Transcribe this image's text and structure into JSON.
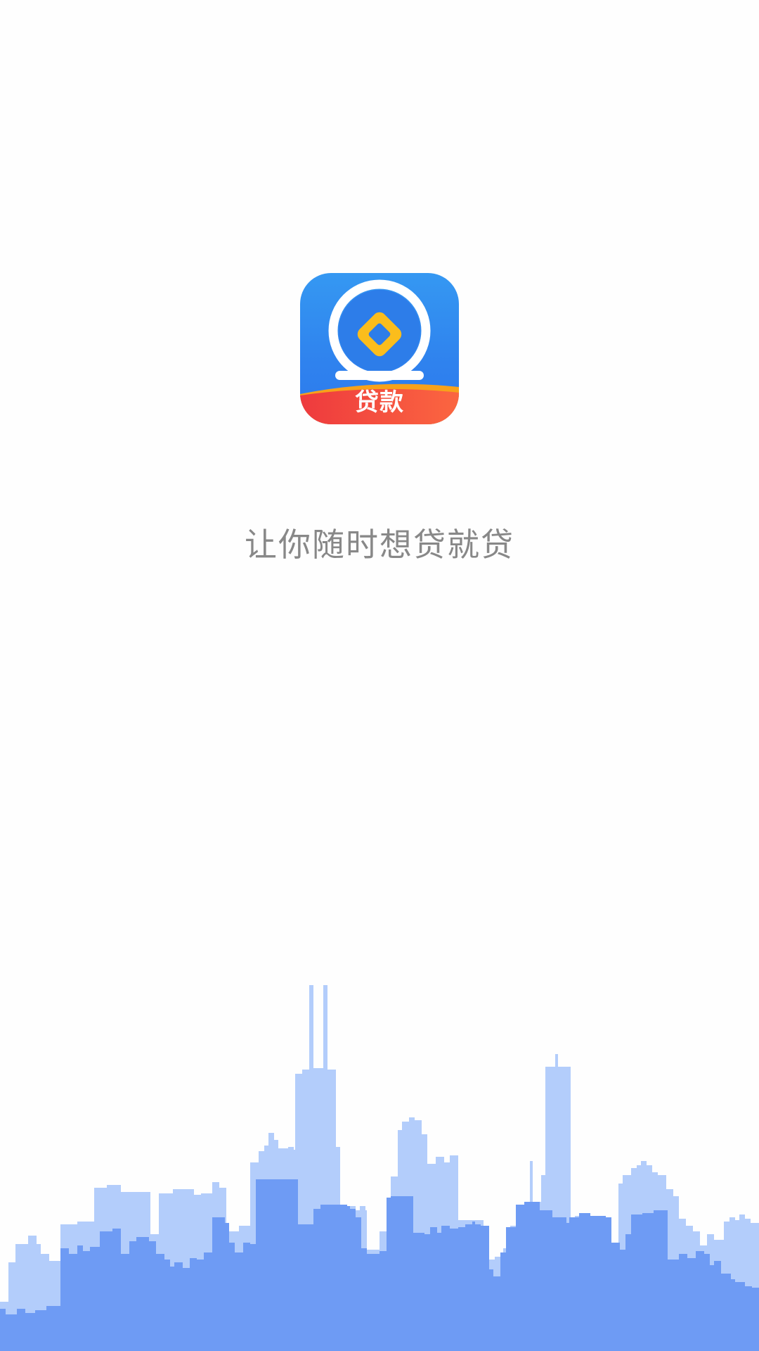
{
  "app": {
    "icon_name": "loan-coin-icon",
    "icon_badge_text": "贷款",
    "slogan": "让你随时想贷就贷"
  },
  "colors": {
    "background": "#fefefe",
    "icon_blue": "#2f82ee",
    "icon_red": "#ee3a3e",
    "icon_orange": "#f7a21a",
    "coin_yellow": "#fbbd1c",
    "skyline_light": "#b3cdfb",
    "skyline_dark": "#6e9bf4",
    "slogan_text": "#888888"
  },
  "decoration": {
    "skyline_icon": "city-skyline-icon"
  }
}
